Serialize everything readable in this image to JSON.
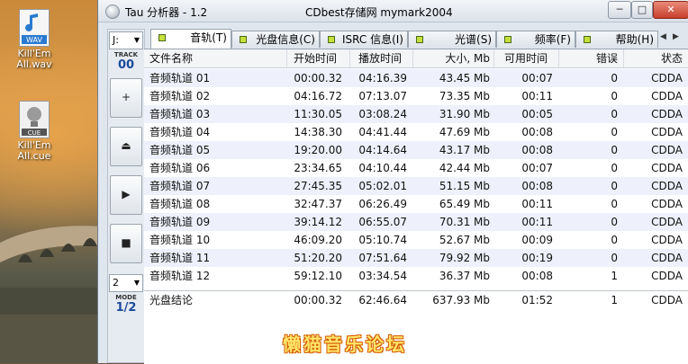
{
  "desktop": {
    "icons": [
      {
        "type": "WAV",
        "label": "Kill'Em All.wav"
      },
      {
        "type": "CUE",
        "label": "Kill'Em All.cue"
      }
    ]
  },
  "window": {
    "title": "Tau 分析器 - 1.2",
    "title_right": "CDbest存储网 mymark2004",
    "minimize": "─",
    "maximize": "□",
    "close": "✕"
  },
  "controls": {
    "drive": "J:",
    "track_caption": "TRACK",
    "track_number": "00",
    "btn_add": "+",
    "btn_eject": "⏏",
    "btn_play": "▶",
    "btn_stop": "■",
    "mode_value": "2",
    "mode_caption": "MODE",
    "mode_number": "1/2"
  },
  "tabs": [
    {
      "label": "音轨(T)",
      "active": true
    },
    {
      "label": "光盘信息(C)",
      "active": false
    },
    {
      "label": "ISRC 信息(I)",
      "active": false
    },
    {
      "label": "光谱(S)",
      "active": false
    },
    {
      "label": "频率(F)",
      "active": false
    },
    {
      "label": "帮助(H)",
      "active": false
    }
  ],
  "table": {
    "columns": [
      "文件名称",
      "开始时间",
      "播放时间",
      "大小, Mb",
      "可用时间",
      "错误",
      "状态"
    ],
    "rows": [
      [
        "音频轨道 01",
        "00:00.32",
        "04:16.39",
        "43.45 Mb",
        "00:07",
        "0",
        "CDDA"
      ],
      [
        "音频轨道 02",
        "04:16.72",
        "07:13.07",
        "73.35 Mb",
        "00:11",
        "0",
        "CDDA"
      ],
      [
        "音频轨道 03",
        "11:30.05",
        "03:08.24",
        "31.90 Mb",
        "00:05",
        "0",
        "CDDA"
      ],
      [
        "音频轨道 04",
        "14:38.30",
        "04:41.44",
        "47.69 Mb",
        "00:08",
        "0",
        "CDDA"
      ],
      [
        "音频轨道 05",
        "19:20.00",
        "04:14.64",
        "43.17 Mb",
        "00:08",
        "0",
        "CDDA"
      ],
      [
        "音频轨道 06",
        "23:34.65",
        "04:10.44",
        "42.44 Mb",
        "00:07",
        "0",
        "CDDA"
      ],
      [
        "音频轨道 07",
        "27:45.35",
        "05:02.01",
        "51.15 Mb",
        "00:08",
        "0",
        "CDDA"
      ],
      [
        "音频轨道 08",
        "32:47.37",
        "06:26.49",
        "65.49 Mb",
        "00:11",
        "0",
        "CDDA"
      ],
      [
        "音频轨道 09",
        "39:14.12",
        "06:55.07",
        "70.31 Mb",
        "00:11",
        "0",
        "CDDA"
      ],
      [
        "音频轨道 10",
        "46:09.20",
        "05:10.74",
        "52.67 Mb",
        "00:09",
        "0",
        "CDDA"
      ],
      [
        "音频轨道 11",
        "51:20.20",
        "07:51.64",
        "79.92 Mb",
        "00:19",
        "0",
        "CDDA"
      ],
      [
        "音频轨道 12",
        "59:12.10",
        "03:34.54",
        "36.37 Mb",
        "00:08",
        "1",
        "CDDA"
      ]
    ],
    "total": [
      "光盘结论",
      "00:00.32",
      "62:46.64",
      "637.93 Mb",
      "01:52",
      "1",
      "CDDA"
    ]
  },
  "watermark": "懒猫音乐论坛"
}
